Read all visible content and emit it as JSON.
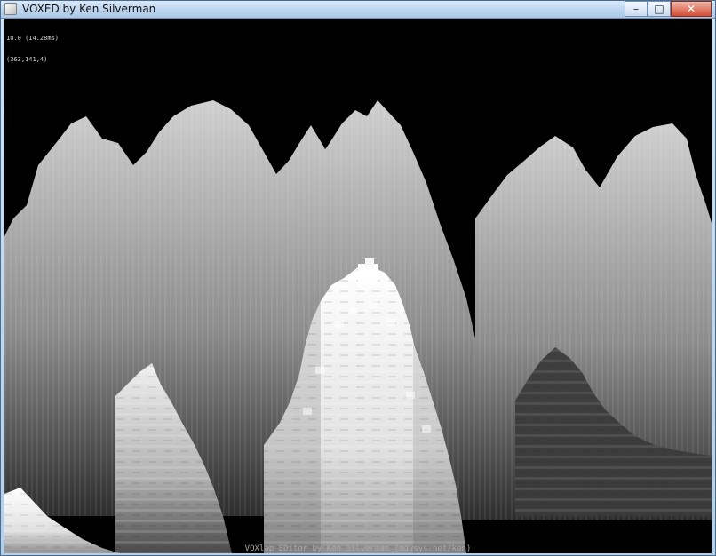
{
  "window": {
    "title": "VOXED by Ken Silverman",
    "controls": {
      "minimize": "–",
      "maximize": "□",
      "close": "✕"
    }
  },
  "hud": {
    "line1": "10.0 (14.28ms)",
    "line2": "(363,141,4)"
  },
  "footer": {
    "credit": "VOXlap EDitor by Ken Silverman (advsys.net/ken)"
  },
  "colors": {
    "background": "#000000",
    "voxel_light": "#f0f0f0",
    "voxel_mid": "#9a9a9a",
    "voxel_dark": "#3c3c3c"
  }
}
